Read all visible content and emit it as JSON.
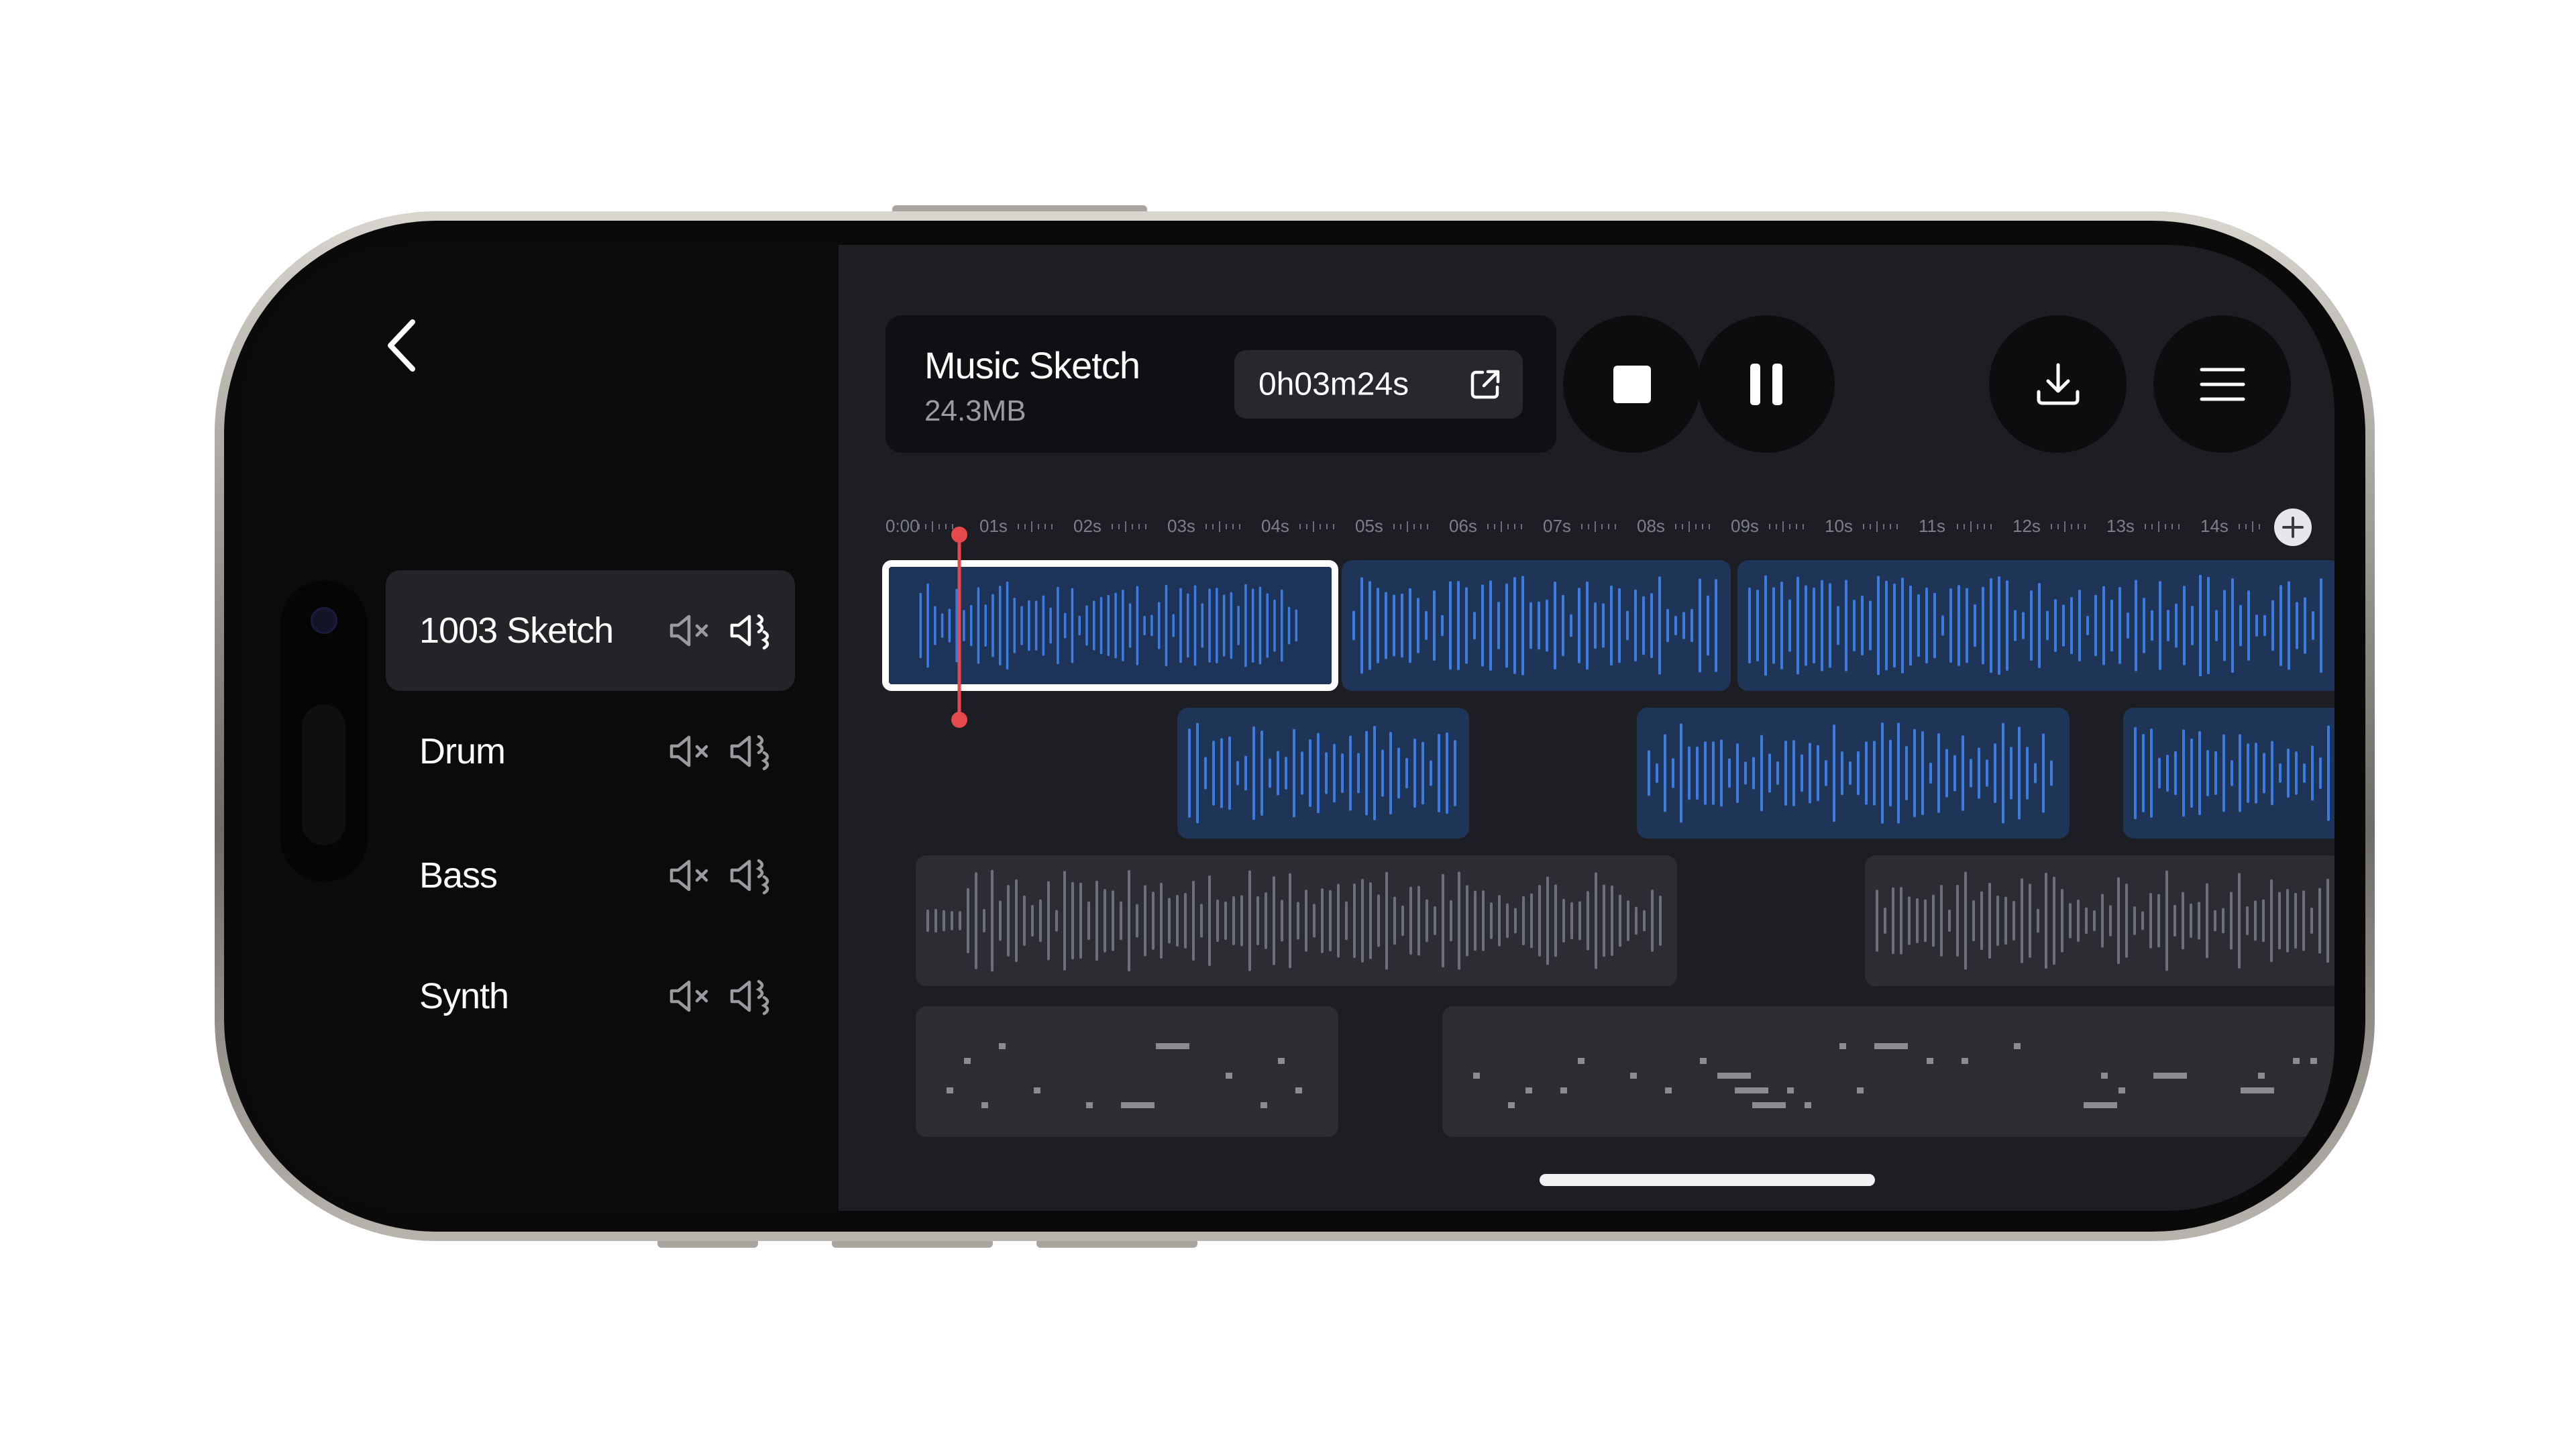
{
  "project": {
    "title": "Music Sketch",
    "size": "24.3MB",
    "duration": "0h03m24s"
  },
  "tracks": [
    {
      "name": "1003 Sketch",
      "active": true
    },
    {
      "name": "Drum",
      "active": false
    },
    {
      "name": "Bass",
      "active": false
    },
    {
      "name": "Synth",
      "active": false
    }
  ],
  "ruler": {
    "labels": [
      "0:00",
      "01s",
      "02s",
      "03s",
      "04s",
      "05s",
      "06s",
      "07s",
      "08s",
      "09s",
      "10s",
      "11s",
      "12s",
      "13s",
      "14s"
    ]
  },
  "colors": {
    "accent_blue": "#3d7be0",
    "clip_blue": "#1f3558",
    "clip_grey": "#2b2d32",
    "playhead_red": "#e5484d",
    "panel_bg": "#1c1e23"
  },
  "icons": {
    "back": "chevron-left-icon",
    "external": "external-link-icon",
    "stop": "stop-icon",
    "pause": "pause-icon",
    "download": "download-icon",
    "menu": "menu-icon",
    "mute": "speaker-mute-icon",
    "solo": "speaker-wave-icon",
    "add": "plus-circle-icon"
  }
}
